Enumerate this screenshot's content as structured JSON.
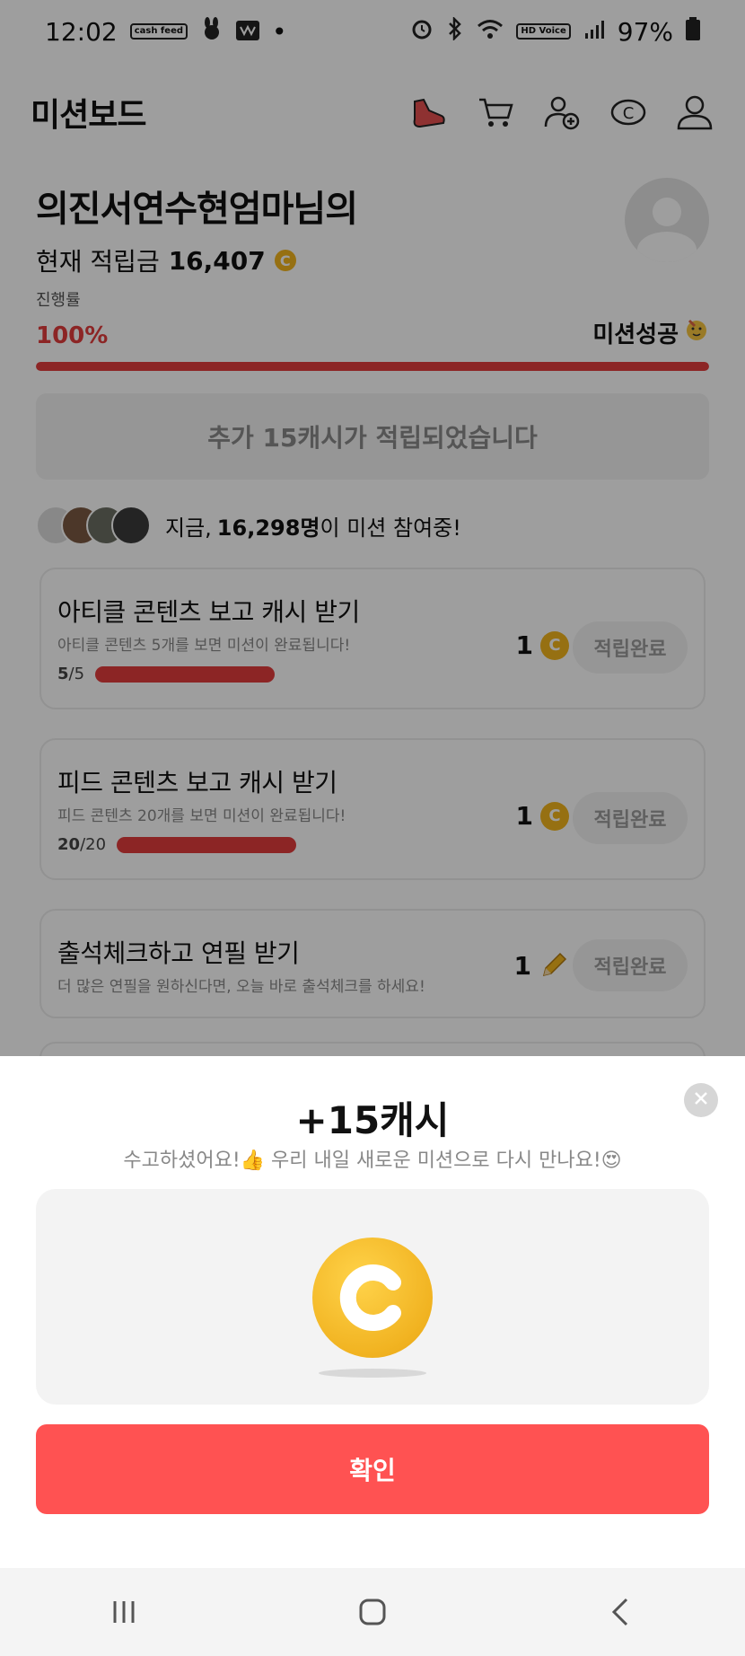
{
  "status_bar": {
    "time": "12:02",
    "left_badges": [
      "cash feed"
    ],
    "battery": "97%",
    "hd_badge": "HD Voice"
  },
  "header": {
    "title": "미션보드"
  },
  "profile": {
    "name": "의진서연수현엄마님의",
    "points_label": "현재 적립금",
    "points_value": "16,407",
    "coin_letter": "C"
  },
  "progress": {
    "label": "진행률",
    "percent_text": "100%",
    "fill": 1.0,
    "success_text": "미션성공"
  },
  "bonus": {
    "text": "추가 15캐시가 적립되었습니다"
  },
  "participants": {
    "prefix": "지금,",
    "count": "16,298명",
    "suffix": "이 미션 참여중!"
  },
  "missions": [
    {
      "title": "아티클 콘텐츠 보고 캐시 받기",
      "desc": "아티클 콘텐츠 5개를 보면 미션이 완료됩니다!",
      "current": "5",
      "total": "/5",
      "reward": "1",
      "button": "적립완료"
    },
    {
      "title": "피드 콘텐츠 보고 캐시 받기",
      "desc": "피드 콘텐츠 20개를 보면 미션이 완료됩니다!",
      "current": "20",
      "total": "/20",
      "reward": "1",
      "button": "적립완료"
    },
    {
      "title": "출석체크하고 연필 받기",
      "desc": "더 많은 연필을 원하신다면, 오늘 바로 출석체크를 하세요!",
      "reward": "1",
      "button": "적립완료"
    }
  ],
  "sheet": {
    "title": "+15캐시",
    "subtitle": "수고하셨어요!👍 우리 내일 새로운 미션으로 다시 만나요!😍",
    "confirm": "확인"
  },
  "colors": {
    "accent": "#e23c3c",
    "button": "#ff5252",
    "coin": "#f2b51e"
  }
}
